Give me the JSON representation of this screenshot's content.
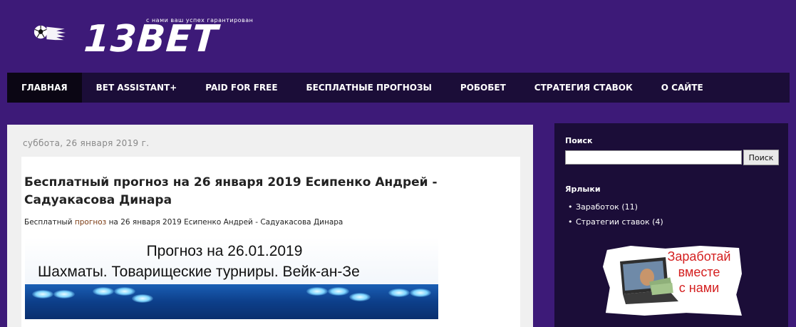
{
  "header": {
    "tagline": "с нами ваш успех гарантирован",
    "logo_text": "13BET"
  },
  "nav": {
    "items": [
      {
        "label": "ГЛАВНАЯ",
        "active": true
      },
      {
        "label": "BET ASSISTANT+",
        "active": false
      },
      {
        "label": "PAID FOR FREE",
        "active": false
      },
      {
        "label": "БЕСПЛАТНЫЕ ПРОГНОЗЫ",
        "active": false
      },
      {
        "label": "РОБОБЕТ",
        "active": false
      },
      {
        "label": "СТРАТЕГИЯ СТАВОК",
        "active": false
      },
      {
        "label": "О САЙТЕ",
        "active": false
      }
    ]
  },
  "main": {
    "date_header": "суббота, 26 января 2019 г.",
    "post": {
      "title": "Бесплатный прогноз на 26 января 2019 Есипенко Андрей - Садуакасова Динара",
      "snippet_start": "Бесплатный ",
      "snippet_tag": "прогноз",
      "snippet_end": " на 26 января 2019 Есипенко Андрей - Садуакасова Динара",
      "banner": {
        "line1": "Прогноз на 26.01.2019",
        "line2": "Шахматы. Товарищеские турниры. Вейк-ан-Зе"
      }
    }
  },
  "sidebar": {
    "search": {
      "heading": "Поиск",
      "input_value": "",
      "button_label": "Поиск"
    },
    "labels": {
      "heading": "Ярлыки",
      "items": [
        {
          "name": "Заработок",
          "count": "(11)"
        },
        {
          "name": "Стратегии ставок",
          "count": "(4)"
        }
      ]
    },
    "promo": {
      "line1": "Заработай",
      "line2": "вместе",
      "line3": "с нами"
    }
  },
  "colors": {
    "page_background": "#3d1a78",
    "nav_background": "#1b0d38",
    "nav_active": "#0b0614",
    "sidebar_background": "#1b0d38",
    "promo_text": "#d42020"
  }
}
